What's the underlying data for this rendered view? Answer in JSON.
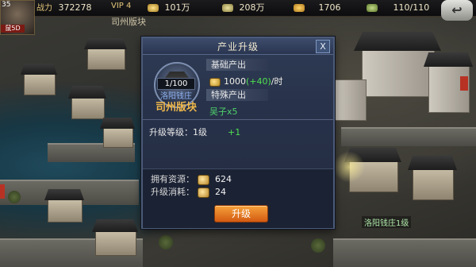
{
  "topbar": {
    "avatar_level": "35",
    "avatar_tag": "鼠5D",
    "power_label": "战力",
    "power_value": "372278",
    "vip_text": "VIP 4",
    "coins": "101万",
    "grain": "208万",
    "iron": "1706",
    "energy": "110/110"
  },
  "subbar": {
    "region": "司州版块"
  },
  "map": {
    "corner_label": "洛阳钱庄1级"
  },
  "dialog": {
    "title": "产业升级",
    "close_label": "X",
    "level_badge": "1/100",
    "property_name": "洛阳钱庄",
    "region_name": "司州版块",
    "base_output_label": "基础产出",
    "output_base": "1000",
    "output_bonus": "(+40)",
    "output_unit": "/时",
    "special_output_label": "特殊产出",
    "special_output": "吴子x5",
    "upgrade_level_label": "升级等级：1级",
    "upgrade_level_plus": "+1",
    "owned_label": "拥有资源：",
    "owned_value": "624",
    "cost_label": "升级消耗：",
    "cost_value": "24",
    "upgrade_button": "升级"
  },
  "colors": {
    "accent_orange": "#f39a35",
    "bonus_green": "#4fe04f",
    "region_gold": "#f0b84a",
    "panel_blue": "#273149"
  }
}
